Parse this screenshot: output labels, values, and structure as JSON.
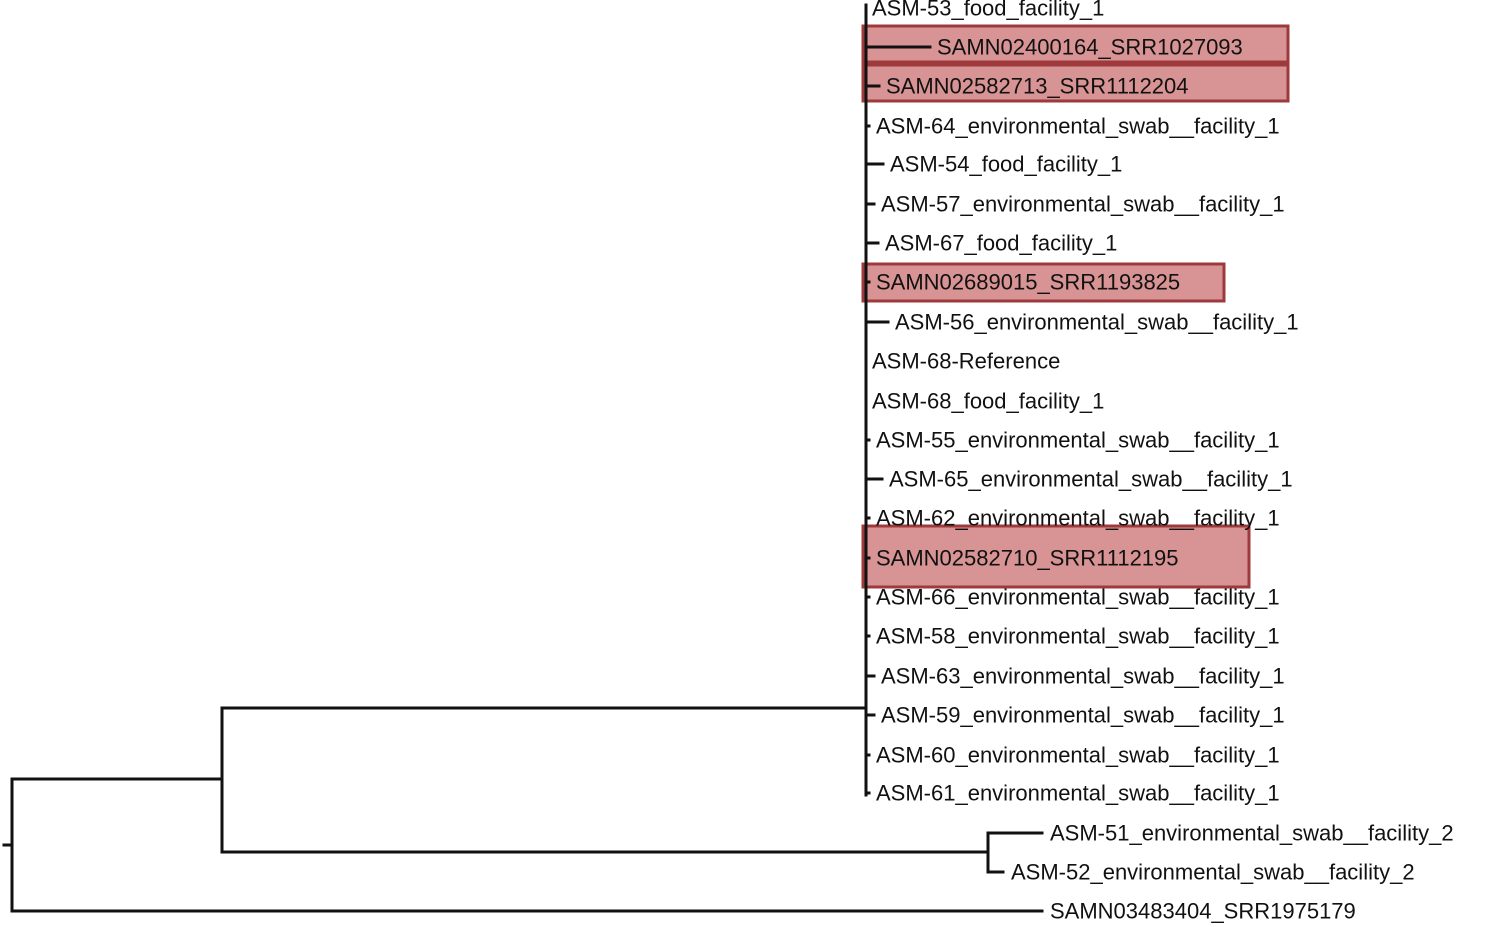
{
  "tree": {
    "highlight_fill": "#d89394",
    "highlight_stroke": "#9e3a3c",
    "line_color": "#111111",
    "tips": [
      {
        "label": "ASM-53_food_facility_1",
        "highlighted": false
      },
      {
        "label": "SAMN02400164_SRR1027093",
        "highlighted": true
      },
      {
        "label": "SAMN02582713_SRR1112204",
        "highlighted": true
      },
      {
        "label": "ASM-64_environmental_swab__facility_1",
        "highlighted": false
      },
      {
        "label": "ASM-54_food_facility_1",
        "highlighted": false
      },
      {
        "label": "ASM-57_environmental_swab__facility_1",
        "highlighted": false
      },
      {
        "label": "ASM-67_food_facility_1",
        "highlighted": false
      },
      {
        "label": "SAMN02689015_SRR1193825",
        "highlighted": true
      },
      {
        "label": "ASM-56_environmental_swab__facility_1",
        "highlighted": false
      },
      {
        "label": "ASM-68-Reference",
        "highlighted": false
      },
      {
        "label": "ASM-68_food_facility_1",
        "highlighted": false
      },
      {
        "label": "ASM-55_environmental_swab__facility_1",
        "highlighted": false
      },
      {
        "label": "ASM-65_environmental_swab__facility_1",
        "highlighted": false
      },
      {
        "label": "ASM-62_environmental_swab__facility_1",
        "highlighted": false
      },
      {
        "label": "SAMN02582710_SRR1112195",
        "highlighted": true
      },
      {
        "label": "ASM-66_environmental_swab__facility_1",
        "highlighted": false
      },
      {
        "label": "ASM-58_environmental_swab__facility_1",
        "highlighted": false
      },
      {
        "label": "ASM-63_environmental_swab__facility_1",
        "highlighted": false
      },
      {
        "label": "ASM-59_environmental_swab__facility_1",
        "highlighted": false
      },
      {
        "label": "ASM-60_environmental_swab__facility_1",
        "highlighted": false
      },
      {
        "label": "ASM-61_environmental_swab__facility_1",
        "highlighted": false
      },
      {
        "label": "ASM-51_environmental_swab__facility_2",
        "highlighted": false
      },
      {
        "label": "ASM-52_environmental_swab__facility_2",
        "highlighted": false
      },
      {
        "label": "SAMN03483404_SRR1975179",
        "highlighted": false
      }
    ]
  }
}
